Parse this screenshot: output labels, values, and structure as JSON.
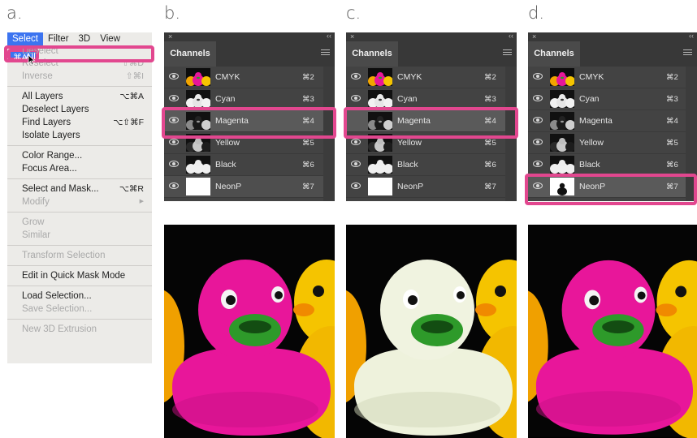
{
  "panel_labels": {
    "a": "a.",
    "b": "b.",
    "c": "c.",
    "d": "d."
  },
  "menu": {
    "bar": [
      "Select",
      "Filter",
      "3D",
      "View"
    ],
    "items": [
      {
        "label": "All",
        "shortcut": "⌘A"
      },
      {
        "label": "Deselect",
        "shortcut": ""
      },
      {
        "label": "Reselect",
        "shortcut": "⇧⌘D"
      },
      {
        "label": "Inverse",
        "shortcut": "⇧⌘I"
      },
      {
        "label": "All Layers",
        "shortcut": "⌥⌘A"
      },
      {
        "label": "Deselect Layers",
        "shortcut": ""
      },
      {
        "label": "Find Layers",
        "shortcut": "⌥⇧⌘F"
      },
      {
        "label": "Isolate Layers",
        "shortcut": ""
      },
      {
        "label": "Color Range...",
        "shortcut": ""
      },
      {
        "label": "Focus Area...",
        "shortcut": ""
      },
      {
        "label": "Select and Mask...",
        "shortcut": "⌥⌘R"
      },
      {
        "label": "Modify",
        "shortcut": "▶"
      },
      {
        "label": "Grow",
        "shortcut": ""
      },
      {
        "label": "Similar",
        "shortcut": ""
      },
      {
        "label": "Transform Selection",
        "shortcut": ""
      },
      {
        "label": "Edit in Quick Mask Mode",
        "shortcut": ""
      },
      {
        "label": "Load Selection...",
        "shortcut": ""
      },
      {
        "label": "Save Selection...",
        "shortcut": ""
      },
      {
        "label": "New 3D Extrusion",
        "shortcut": ""
      }
    ]
  },
  "channels_panel": {
    "close_glyph": "×",
    "collapse_glyph": "‹‹",
    "tab_label": "Channels",
    "rows": [
      {
        "name": "CMYK",
        "shortcut": "⌘2"
      },
      {
        "name": "Cyan",
        "shortcut": "⌘3"
      },
      {
        "name": "Magenta",
        "shortcut": "⌘4"
      },
      {
        "name": "Yellow",
        "shortcut": "⌘5"
      },
      {
        "name": "Black",
        "shortcut": "⌘6"
      },
      {
        "name": "NeonP",
        "shortcut": "⌘7"
      }
    ]
  },
  "colors": {
    "highlight": "#e2478f",
    "menu_selection": "#3c74f0",
    "duck_pink": "#e8169a",
    "duck_white": "#eef2dc",
    "duck_yellow": "#f5c400",
    "beak_green": "#2e9a2a"
  }
}
